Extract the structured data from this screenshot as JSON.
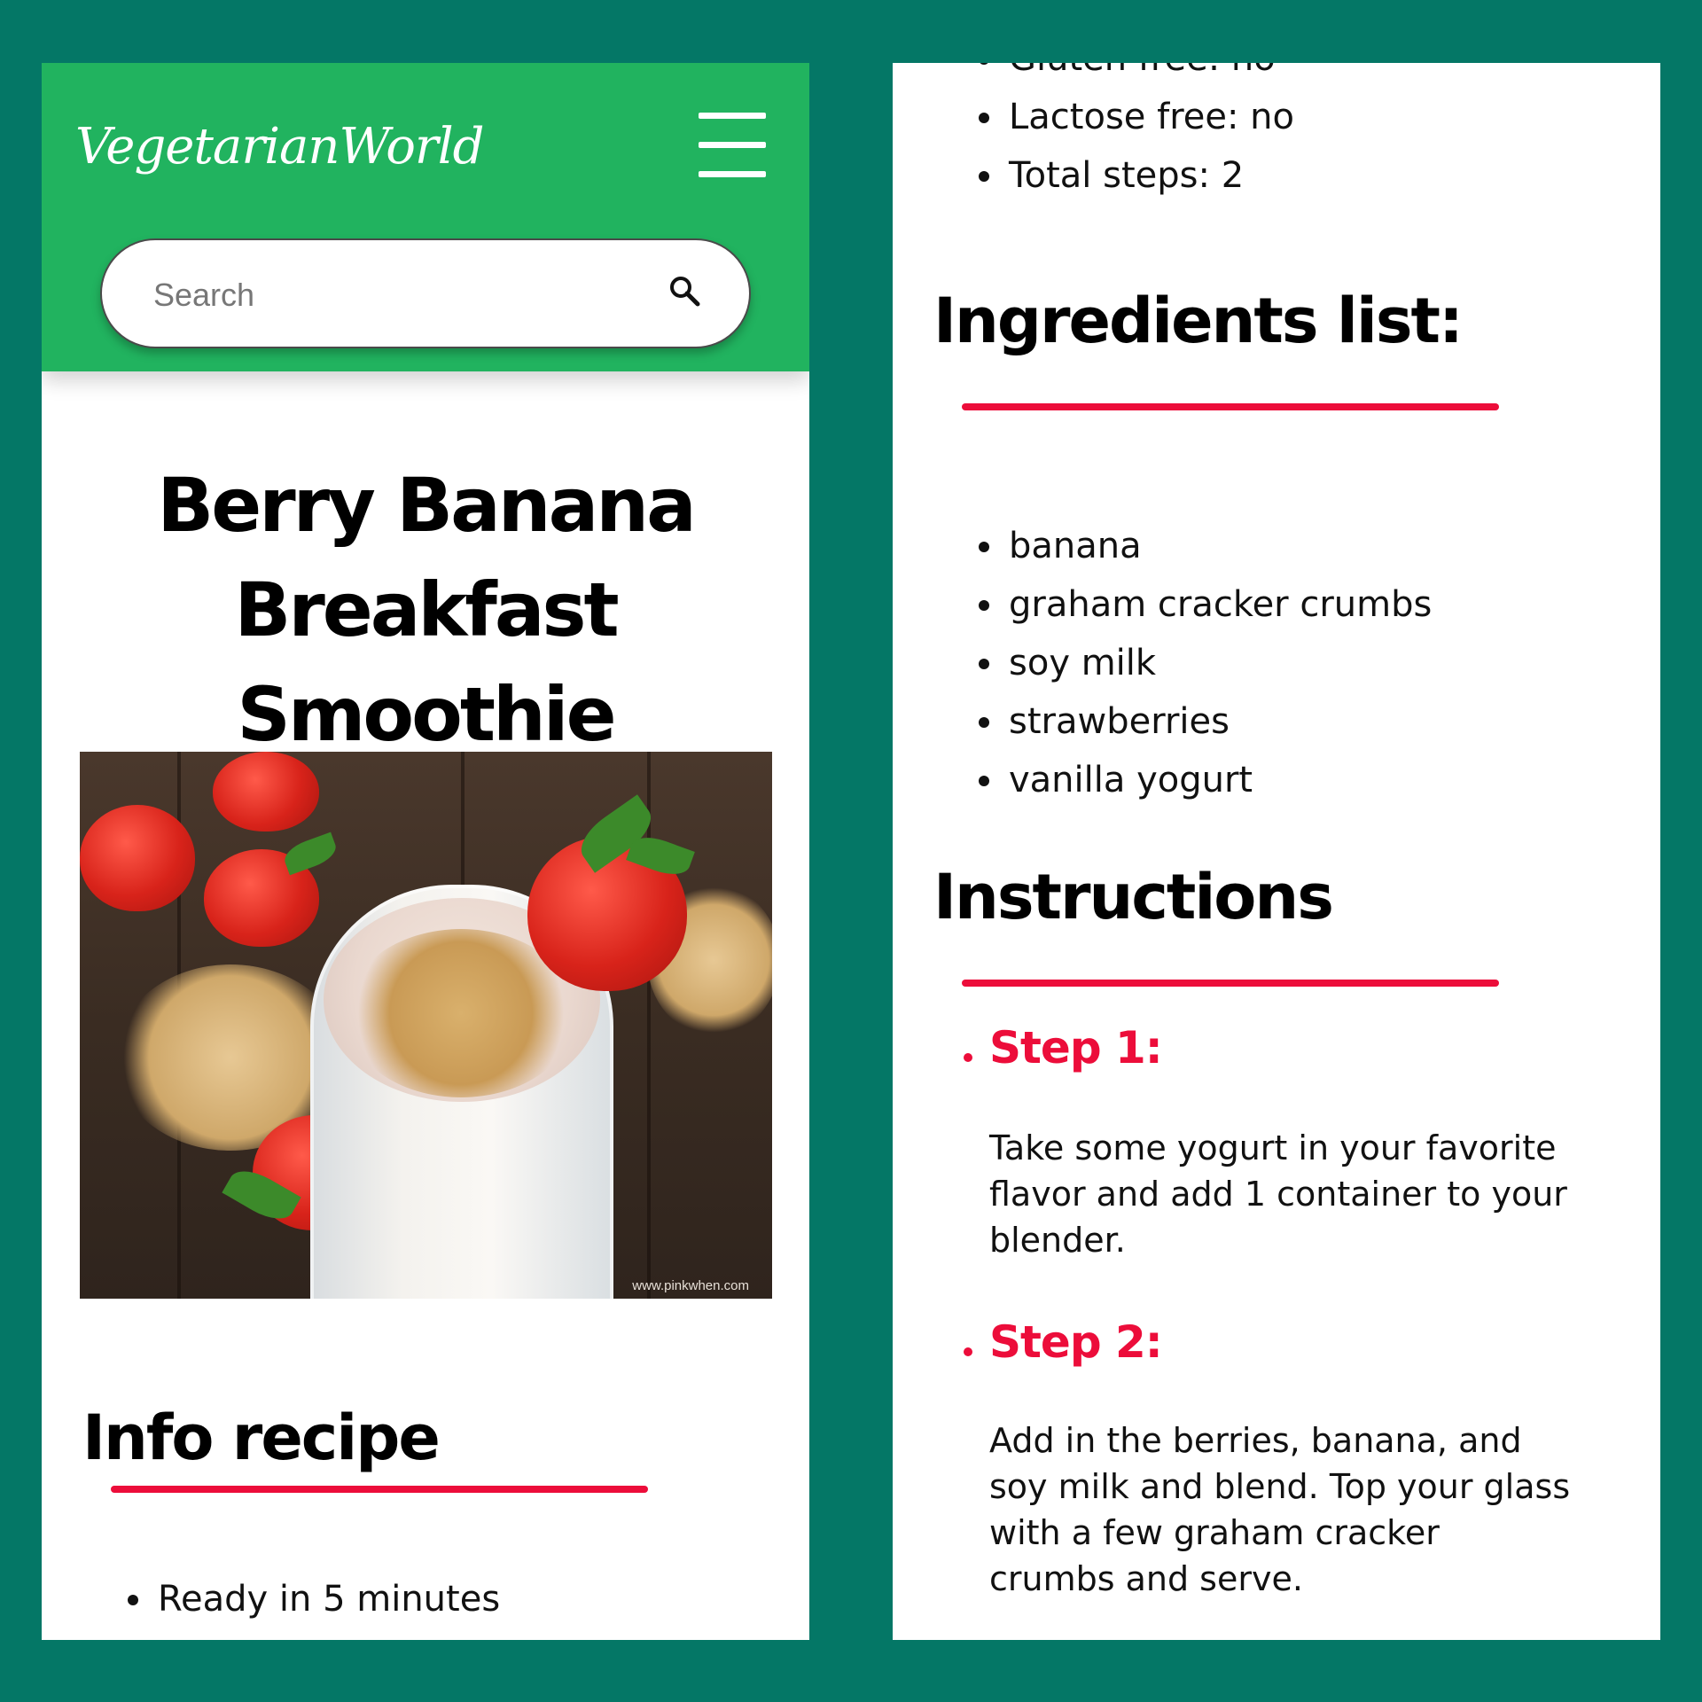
{
  "app": {
    "logo_text": "VegetarianWorld"
  },
  "header": {
    "search_placeholder": "Search"
  },
  "recipe": {
    "title": "Berry Banana Breakfast Smoothie",
    "image_watermark": "www.pinkwhen.com",
    "info_heading": "Info recipe",
    "info_items": [
      "Ready in 5 minutes"
    ],
    "info_items_continued": [
      "Gluten free: no",
      "Lactose free: no",
      "Total steps: 2"
    ],
    "ingredients_heading": "Ingredients list:",
    "ingredients": [
      "banana",
      "graham cracker crumbs",
      "soy milk",
      "strawberries",
      "vanilla yogurt"
    ],
    "instructions_heading": "Instructions",
    "steps": [
      {
        "label": "Step 1:",
        "text": "Take some yogurt in your favorite flavor and add 1 container to your blender."
      },
      {
        "label": "Step 2:",
        "text": "Add in the berries, banana, and soy milk and blend. Top your glass with a few graham cracker crumbs and serve."
      }
    ]
  },
  "colors": {
    "header_green": "#21b35f",
    "background_teal": "#047766",
    "accent_red": "#ec0d3a"
  }
}
